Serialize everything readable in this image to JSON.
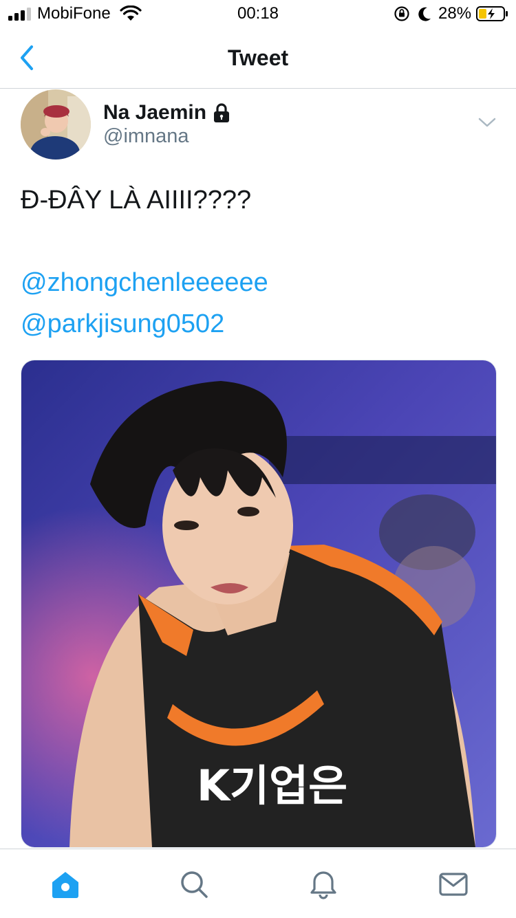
{
  "status_bar": {
    "carrier": "MobiFone",
    "time": "00:18",
    "battery_percent": "28%",
    "signal_bars": 3
  },
  "nav": {
    "title": "Tweet",
    "back_icon": "chevron-left-icon"
  },
  "tweet": {
    "display_name": "Na Jaemin",
    "handle": "@imnana",
    "protected": true,
    "text": "Đ-ĐÂY LÀ AIIII????",
    "mentions": [
      "@zhongchenleeeeee",
      "@parkjisung0502"
    ]
  },
  "tab_bar": {
    "items": [
      "home-icon",
      "search-icon",
      "bell-icon",
      "mail-icon"
    ],
    "active": "home-icon"
  },
  "colors": {
    "accent": "#1da1f2",
    "text": "#14171a",
    "secondary": "#657786",
    "divider": "#cfd4d9"
  }
}
